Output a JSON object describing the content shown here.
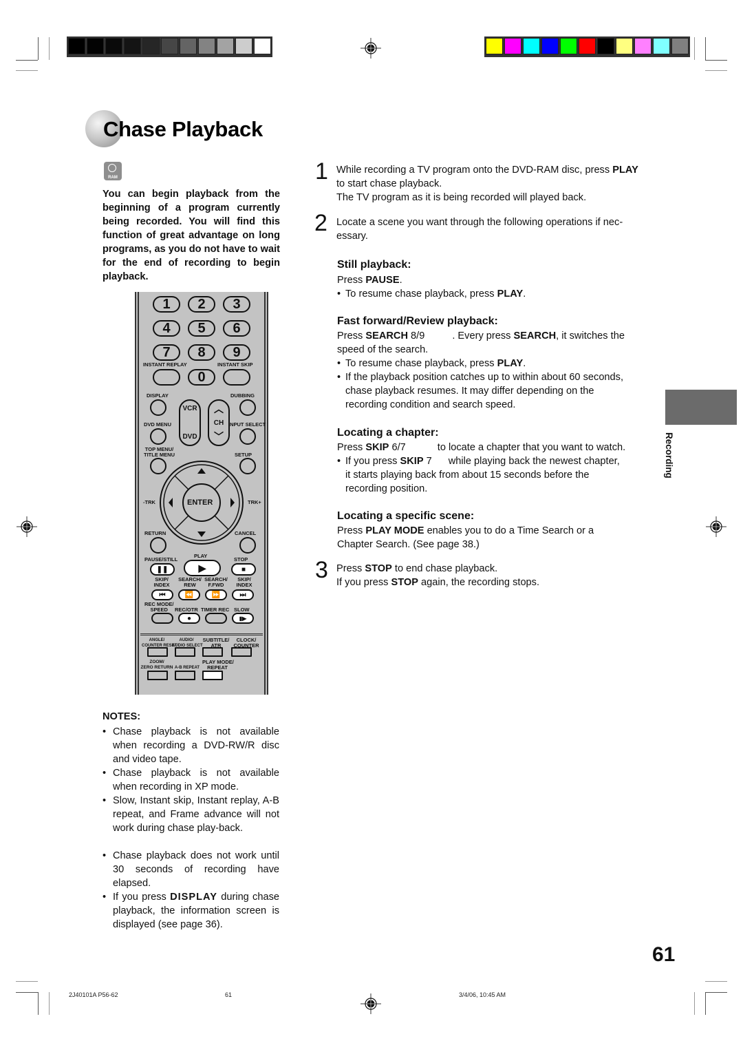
{
  "print_marks": {
    "grayscale_bar": [
      "#000000",
      "#030303",
      "#0a0a0a",
      "#141414",
      "#262626",
      "#464646",
      "#646464",
      "#838383",
      "#a3a3a3",
      "#cdcdcd",
      "#ffffff"
    ],
    "color_bar": [
      "#ffff00",
      "#ff00ff",
      "#00ffff",
      "#0000ff",
      "#00ff00",
      "#ff0000",
      "#000000",
      "#ffff80",
      "#ff80ff",
      "#80ffff",
      "#808080"
    ]
  },
  "header": {
    "title": "Chase Playback",
    "disc_badge": "RAM"
  },
  "intro": "You can begin playback from the beginning of a program currently being recorded. You will find this function of great advantage on long programs, as you do not have to wait for the end of recording to begin playback.",
  "remote": {
    "digits": [
      "1",
      "2",
      "3",
      "4",
      "5",
      "6",
      "7",
      "8",
      "9",
      "0"
    ],
    "labels": {
      "instant_replay": "INSTANT REPLAY",
      "instant_skip": "INSTANT SKIP",
      "display": "DISPLAY",
      "dubbing": "DUBBING",
      "vcr": "VCR",
      "dvd": "DVD",
      "ch": "CH",
      "dvd_menu": "DVD MENU",
      "input_select": "INPUT SELECT",
      "top_menu": "TOP MENU/",
      "title_menu": "TITLE MENU",
      "setup": "SETUP",
      "enter": "ENTER",
      "trk_minus": "-TRK",
      "trk_plus": "TRK+",
      "return": "RETURN",
      "cancel": "CANCEL",
      "play": "PLAY",
      "pause_still": "PAUSE/STILL",
      "stop": "STOP",
      "skip_index_prev": "SKIP/\nINDEX",
      "search_rew": "SEARCH/\nREW",
      "search_ffwd": "SEARCH/\nF.FWD",
      "skip_index_next": "SKIP/\nINDEX",
      "rec_mode_speed": "REC MODE/\nSPEED",
      "rec_otr": "REC/OTR",
      "timer_rec": "TIMER REC",
      "slow": "SLOW",
      "angle": "ANGLE/\nCOUNTER RESET",
      "audio": "AUDIO/\nAUDIO SELECT",
      "subtitle": "SUBTITLE/\nATR",
      "clock": "CLOCK/\nCOUNTER",
      "zoom": "ZOOM/\nZERO RETURN",
      "ab_repeat": "A-B REPEAT",
      "play_mode": "PLAY MODE/\nREPEAT"
    }
  },
  "steps": [
    {
      "num": "1",
      "line1_a": "While recording a TV program onto the DVD-RAM disc, press ",
      "line1_b": "PLAY",
      "line2": "to start chase playback.",
      "line3": "The TV program as it is being recorded will played back."
    },
    {
      "num": "2",
      "line1": "Locate a scene you want through the following operations if nec-",
      "line2": "essary."
    },
    {
      "num": "3",
      "line1_a": "Press ",
      "line1_b": "STOP",
      "line1_c": " to end chase playback.",
      "line2_a": "If you press ",
      "line2_b": "STOP",
      "line2_c": " again, the recording stops."
    }
  ],
  "sections": {
    "still": {
      "heading": "Still playback:",
      "press_a": "Press ",
      "press_b": "PAUSE",
      "press_c": ".",
      "bullet_a": "To resume chase playback, press ",
      "bullet_b": "PLAY",
      "bullet_c": "."
    },
    "ff": {
      "heading": "Fast forward/Review playback:",
      "l1_a": "Press ",
      "l1_b": "SEARCH",
      "l1_c": " 8/9",
      "l1_d": ". Every press ",
      "l1_e": "SEARCH",
      "l1_f": ", it switches the",
      "l2": "speed of the search.",
      "b1_a": "To resume chase playback, press ",
      "b1_b": "PLAY",
      "b1_c": ".",
      "b2_l1": "If the playback position catches up to within about 60 seconds,",
      "b2_l2": "chase playback resumes. It may differ depending on the",
      "b2_l3": "recording condition and search speed."
    },
    "chapter": {
      "heading": "Locating a chapter:",
      "l1_a": "Press ",
      "l1_b": "SKIP",
      "l1_c": " 6/7",
      "l1_d": "to locate a chapter that you want to watch.",
      "b_a": "If you press ",
      "b_b": "SKIP",
      "b_c": " 7",
      "b_d": "while playing back the newest chapter,",
      "b_l2": "it starts playing back from about 15 seconds before the",
      "b_l3": "recording position."
    },
    "scene": {
      "heading": "Locating a specific scene:",
      "l1_a": "Press ",
      "l1_b": "PLAY MODE",
      "l1_c": " enables you to do a Time Search or a",
      "l2": "Chapter Search. (See page 38.)"
    }
  },
  "side_tab": "Recording",
  "notes": {
    "heading": "NOTES:",
    "items": [
      "Chase playback is not available when recording a DVD-RW/R disc and video tape.",
      "Chase playback is not available when recording in XP mode.",
      "Slow, Instant skip, Instant replay, A-B repeat, and Frame advance will not work during chase play-back.",
      "Chase playback does not work until 30 seconds of recording have elapsed."
    ],
    "last_a": "If you press ",
    "last_b": "DISPLAY",
    "last_c": " during chase playback, the information screen is displayed (see page 36)."
  },
  "page_number": "61",
  "footer": {
    "job": "2J40101A P56-62",
    "page": "61",
    "timestamp": "3/4/06, 10:45 AM"
  }
}
